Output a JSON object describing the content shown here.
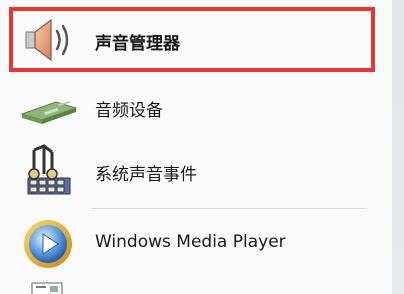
{
  "menu": {
    "items": [
      {
        "label": "声音管理器",
        "icon": "speaker-icon",
        "highlighted": true
      },
      {
        "label": "音频设备",
        "icon": "audio-device-icon"
      },
      {
        "label": "系统声音事件",
        "icon": "system-sounds-icon"
      },
      {
        "label": "Windows Media Player",
        "icon": "media-player-icon"
      }
    ]
  },
  "colors": {
    "highlight_border": "#e63535",
    "menu_background": "#fafafa"
  }
}
